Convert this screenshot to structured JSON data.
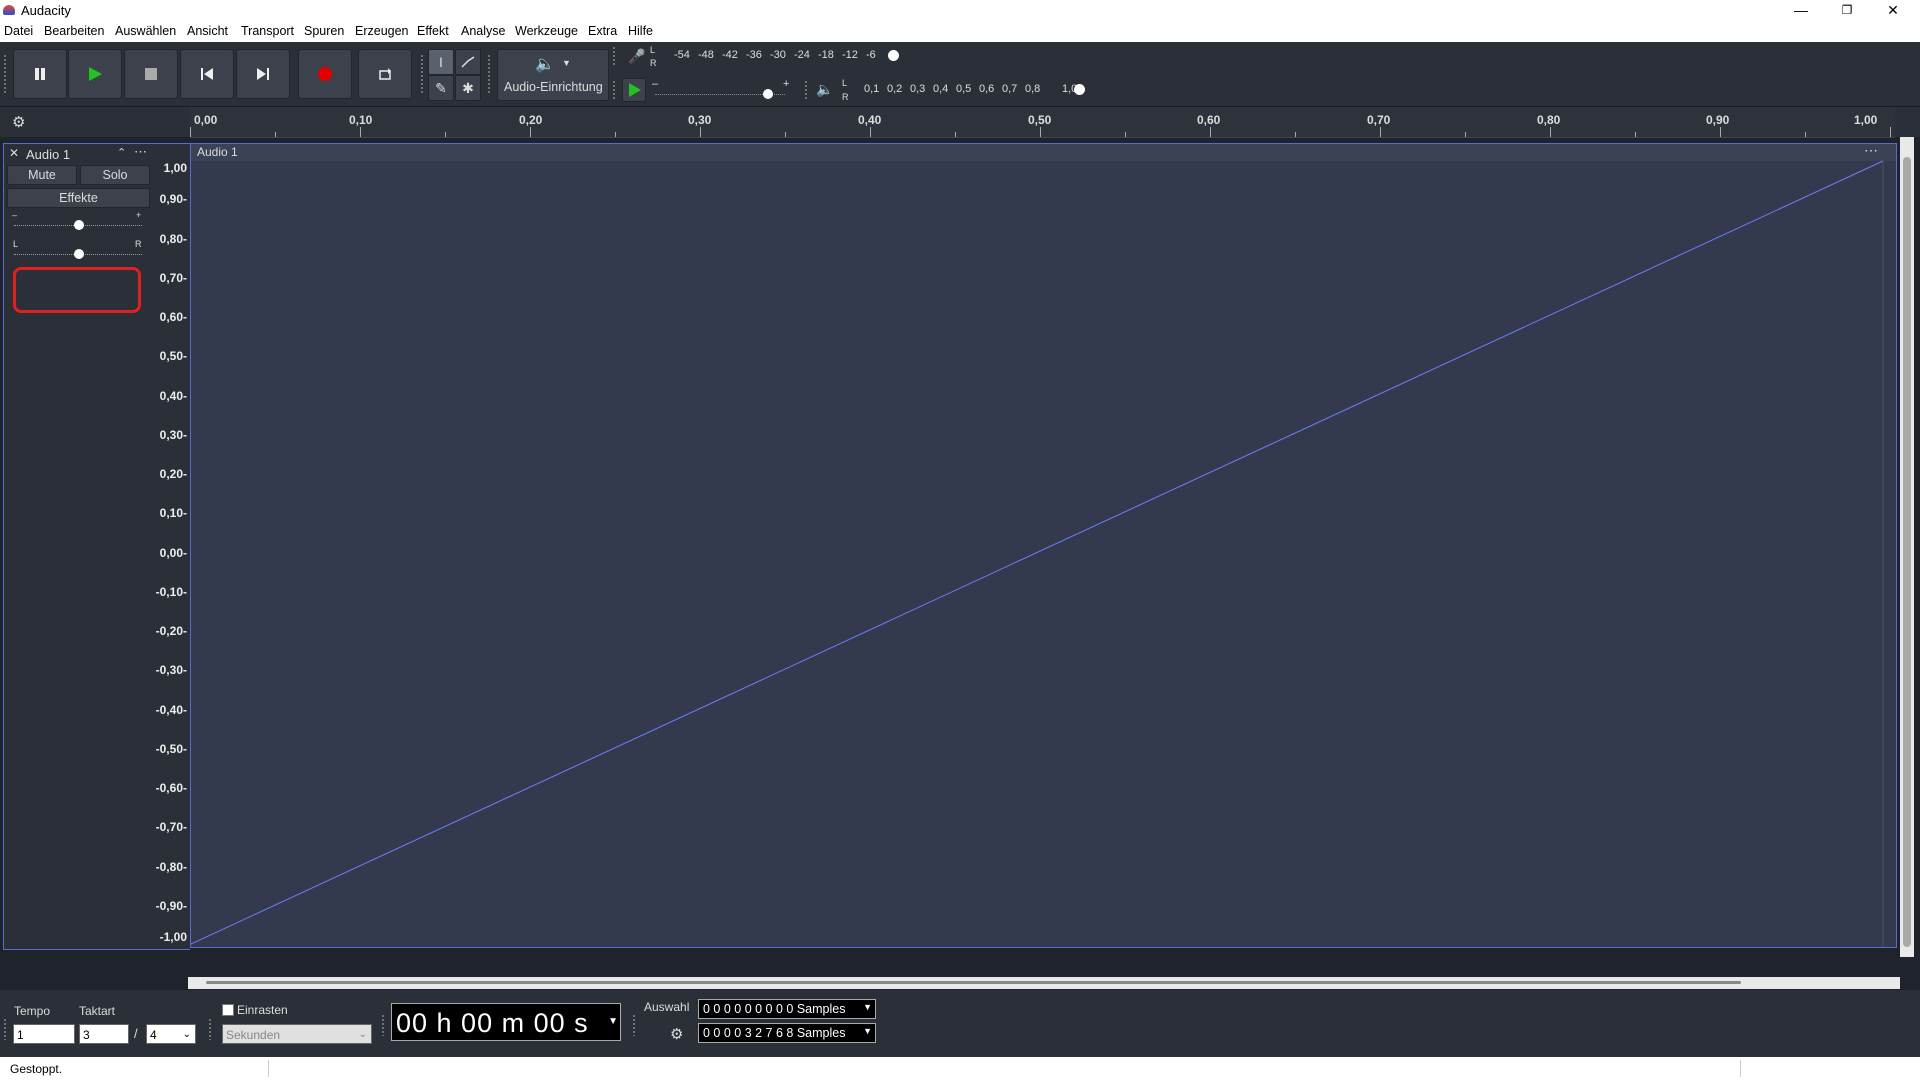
{
  "app": {
    "title": "Audacity"
  },
  "menu": [
    "Datei",
    "Bearbeiten",
    "Auswählen",
    "Ansicht",
    "Transport",
    "Spuren",
    "Erzeugen",
    "Effekt",
    "Analyse",
    "Werkzeuge",
    "Extra",
    "Hilfe"
  ],
  "toolbar": {
    "audio_setup_label": "Audio-Einrichtung",
    "record_meter_ticks": [
      "-54",
      "-48",
      "-42",
      "-36",
      "-30",
      "-24",
      "-18",
      "-12",
      "-6"
    ],
    "play_meter_ticks": [
      "0,1",
      "0,2",
      "0,3",
      "0,4",
      "0,5",
      "0,6",
      "0,7",
      "0,8",
      "1,0"
    ],
    "lr_l": "L",
    "lr_r": "R",
    "minus": "–",
    "plus": "+"
  },
  "ruler": {
    "ticks": [
      "0,00",
      "0,10",
      "0,20",
      "0,30",
      "0,40",
      "0,50",
      "0,60",
      "0,70",
      "0,80",
      "0,90",
      "1,00"
    ]
  },
  "track": {
    "name": "Audio 1",
    "mute_label": "Mute",
    "solo_label": "Solo",
    "effects_label": "Effekte",
    "pan_left": "L",
    "pan_right": "R",
    "gain_minus": "–",
    "gain_plus": "+",
    "clip_name": "Audio 1",
    "scale": [
      "1,00",
      "0,90-",
      "0,80-",
      "0,70-",
      "0,60-",
      "0,50-",
      "0,40-",
      "0,30-",
      "0,20-",
      "0,10-",
      "0,00-",
      "-0,10-",
      "-0,20-",
      "-0,30-",
      "-0,40-",
      "-0,50-",
      "-0,60-",
      "-0,70-",
      "-0,80-",
      "-0,90-",
      "-1,00"
    ]
  },
  "bottom": {
    "tempo_label": "Tempo",
    "tempo_value": "1",
    "timesig_label": "Taktart",
    "timesig_num": "3",
    "timesig_sep": "/",
    "timesig_den": "4",
    "snap_label": "Einrasten",
    "snap_unit": "Sekunden",
    "time_display": "00 h 00 m 00 s",
    "selection_label": "Auswahl",
    "sel_start": "0 0 0 0 0 0 0 0 0 Samples",
    "sel_end": "0 0 0 0 3 2 7 6 8 Samples"
  },
  "status": {
    "text": "Gestoppt."
  },
  "colors": {
    "wave_bg": "#333a4d",
    "wave_line": "#6f7cff",
    "record": "#e00000",
    "play": "#22c222",
    "highlight": "#e02020"
  }
}
